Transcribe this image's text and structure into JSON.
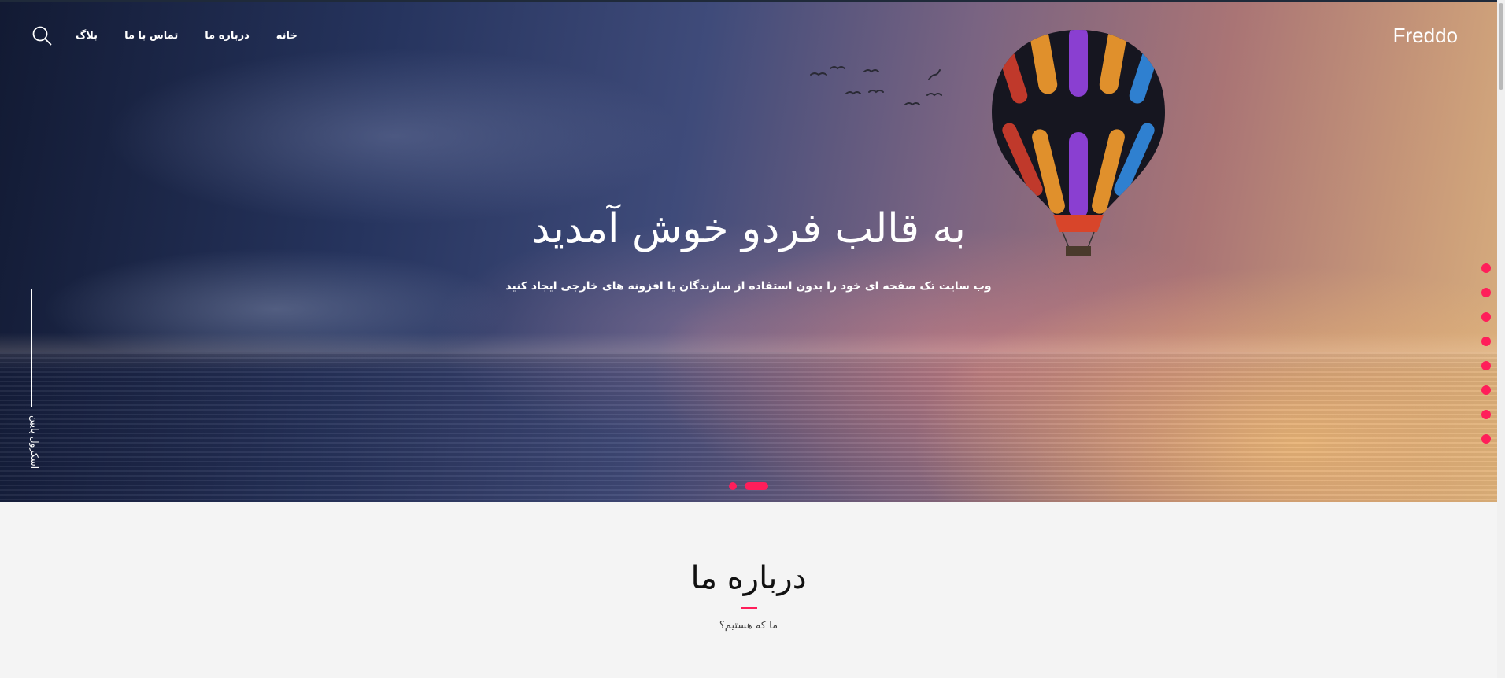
{
  "brand": "Freddo",
  "nav": {
    "items": [
      {
        "label": "خانه"
      },
      {
        "label": "درباره ما"
      },
      {
        "label": "تماس با ما"
      },
      {
        "label": "بلاگ"
      }
    ],
    "search_icon": "search-icon"
  },
  "hero": {
    "title": "به قالب فردو خوش آمدید",
    "subtitle": "وب سایت تک صفحه ای خود را بدون استفاده از سازندگان یا افزونه های خارجی ایجاد کنید",
    "scroll_label": "اسکرول پایین",
    "side_dots_count": 8,
    "slider": {
      "slides": 2,
      "active_index": 1
    }
  },
  "about": {
    "title": "درباره ما",
    "subtitle": "ما که هستیم؟"
  },
  "colors": {
    "accent": "#ff1e5a",
    "text_light": "#ffffff",
    "section_bg": "#f4f4f4"
  }
}
